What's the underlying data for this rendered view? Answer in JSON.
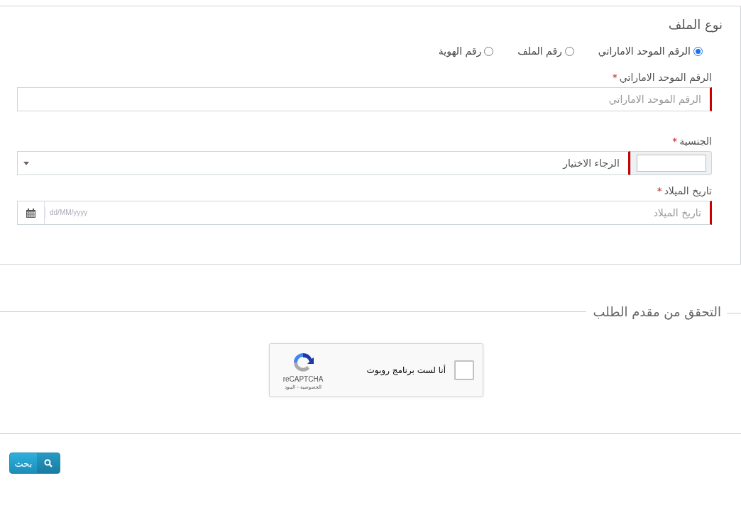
{
  "file_type": {
    "title": "نوع الملف",
    "options": [
      {
        "label": "الرقم الموحد الاماراتي",
        "selected": true
      },
      {
        "label": "رقم الملف",
        "selected": false
      },
      {
        "label": "رقم الهوية",
        "selected": false
      }
    ]
  },
  "fields": [
    {
      "kind": "text",
      "label": "الرقم الموحد الاماراتي",
      "required_mark": "*",
      "placeholder": "الرقم الموحد الاماراتي"
    },
    {
      "kind": "select",
      "label": "الجنسية",
      "required_mark": "*",
      "placeholder": "الرجاء الاختيار"
    },
    {
      "kind": "date",
      "label": "تاريخ الميلاد",
      "required_mark": "*",
      "placeholder": "تاريخ الميلاد",
      "format_hint": "dd/MM/yyyy"
    }
  ],
  "verification": {
    "legend": "التحقق من مقدم الطلب",
    "captcha": {
      "label": "أنا لست برنامج روبوت",
      "checked": false,
      "brand": "reCAPTCHA",
      "links": "الخصوصية - البنود"
    }
  },
  "search_button": {
    "label": "بحث"
  }
}
